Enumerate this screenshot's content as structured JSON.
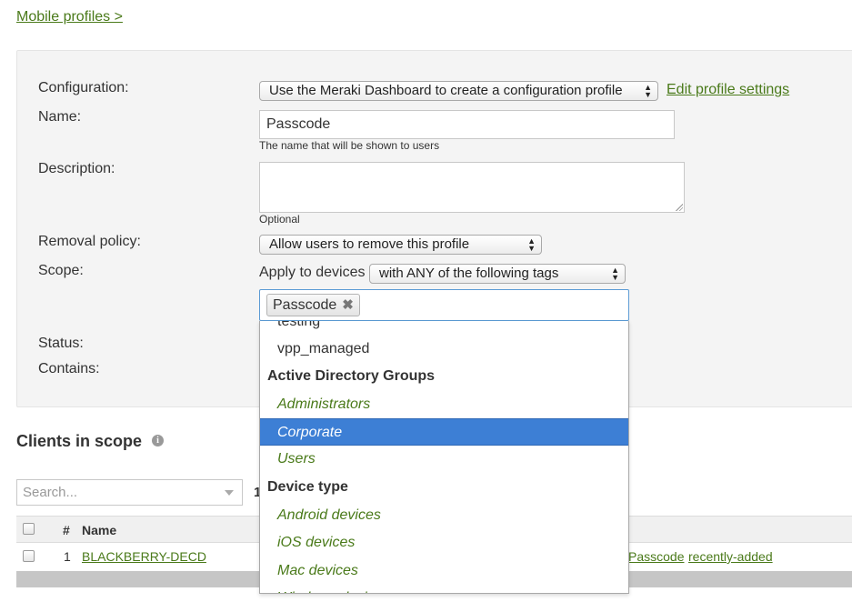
{
  "breadcrumb": {
    "label": "Mobile profiles >"
  },
  "form": {
    "configuration": {
      "label": "Configuration:",
      "value": "Use the Meraki Dashboard to create a configuration profile",
      "edit_link": "Edit profile settings"
    },
    "name": {
      "label": "Name:",
      "value": "Passcode",
      "hint": "The name that will be shown to users"
    },
    "description": {
      "label": "Description:",
      "value": "",
      "hint": "Optional"
    },
    "removal_policy": {
      "label": "Removal policy:",
      "value": "Allow users to remove this profile"
    },
    "scope": {
      "label": "Scope:",
      "prefix": "Apply to devices",
      "mode": "with ANY of the following tags",
      "selected_tags": [
        "Passcode"
      ]
    },
    "status": {
      "label": "Status:"
    },
    "contains": {
      "label": "Contains:"
    }
  },
  "tag_dropdown": {
    "options": [
      {
        "kind": "option",
        "label": "testing",
        "italic": false
      },
      {
        "kind": "option",
        "label": "vpp_managed",
        "italic": false
      },
      {
        "kind": "group",
        "label": "Active Directory Groups"
      },
      {
        "kind": "option",
        "label": "Administrators",
        "italic": true
      },
      {
        "kind": "option",
        "label": "Corporate",
        "italic": true,
        "highlighted": true
      },
      {
        "kind": "option",
        "label": "Users",
        "italic": true
      },
      {
        "kind": "group",
        "label": "Device type"
      },
      {
        "kind": "option",
        "label": "Android devices",
        "italic": true
      },
      {
        "kind": "option",
        "label": "iOS devices",
        "italic": true
      },
      {
        "kind": "option",
        "label": "Mac devices",
        "italic": true
      },
      {
        "kind": "option",
        "label": "Windows devices",
        "italic": true
      }
    ]
  },
  "clients": {
    "title": "Clients in scope",
    "info_icon": "info-icon",
    "search_placeholder": "Search...",
    "count_fragment": "1",
    "columns": {
      "number": "#",
      "name": "Name"
    },
    "rows": [
      {
        "number": "1",
        "name": "BLACKBERRY-DECD",
        "tags": [
          "Passcode",
          "recently-added"
        ]
      }
    ]
  },
  "colors": {
    "link": "#4a7a1a",
    "highlight": "#3d7fd5",
    "panel_bg": "#f4f4f4"
  }
}
